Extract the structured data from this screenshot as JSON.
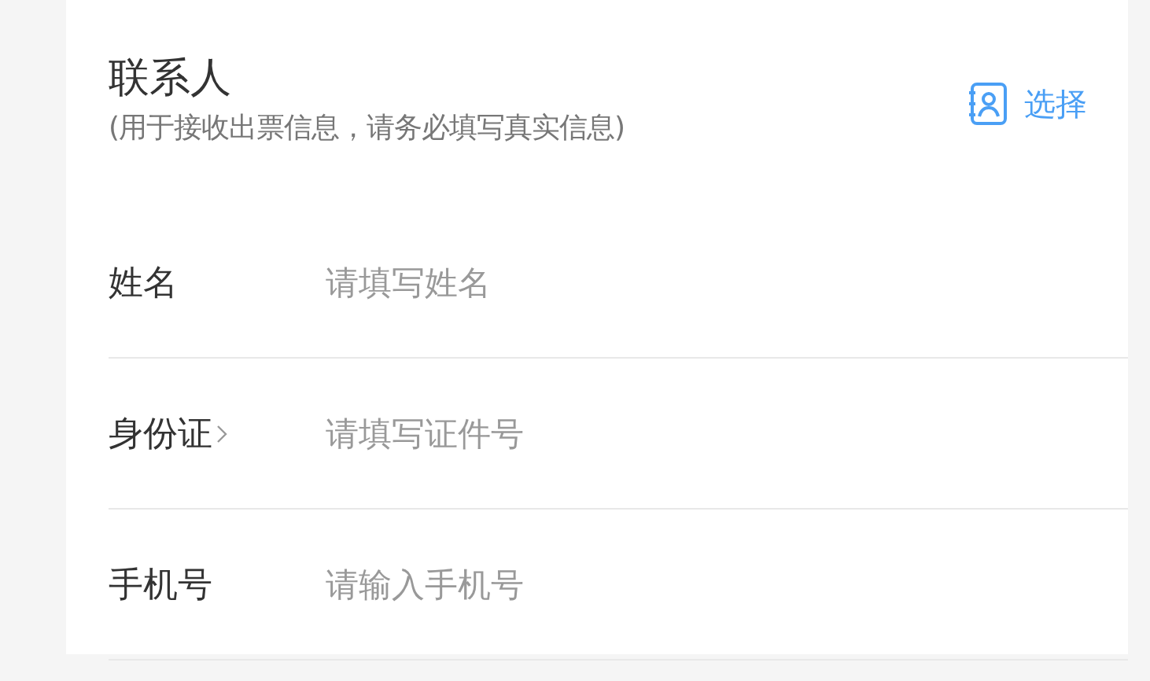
{
  "header": {
    "title": "联系人",
    "subtitle": "(用于接收出票信息，请务必填写真实信息)",
    "action": "选择"
  },
  "fields": [
    {
      "kind": "text",
      "label": "姓名",
      "placeholder": "请填写姓名"
    },
    {
      "kind": "picker",
      "label": "身份证",
      "placeholder": "请填写证件号"
    },
    {
      "kind": "text",
      "label": "手机号",
      "placeholder": "请输入手机号"
    }
  ]
}
